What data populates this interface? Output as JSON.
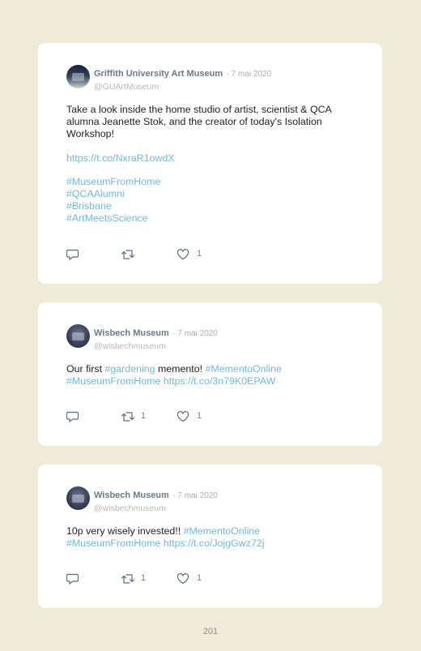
{
  "tweets": [
    {
      "name": "Griffith University Art Museum",
      "date": "· 7 mai 2020",
      "handle": "@GUArtMuseum",
      "lines": [
        {
          "text": "Take a look inside the home studio of artist, scientist & QCA"
        },
        {
          "text": "alumna Jeanette Stok, and the creator of today's Isolation"
        },
        {
          "text": "Workshop!"
        },
        {
          "link": "https://t.co/NxraR1owdX"
        },
        {
          "link": "#MuseumFromHome"
        },
        {
          "link": "#QCAAlumni"
        },
        {
          "link": "#Brisbane"
        },
        {
          "link": "#ArtMeetsScience"
        }
      ],
      "reply_count": "",
      "retweet_count": "",
      "like_count": "1"
    },
    {
      "name": "Wisbech Museum",
      "date": "· 7 mai 2020",
      "handle": "@wisbechmuseum",
      "line1": {
        "t1": "Our first ",
        "l1": "#gardening",
        "t2": " memento! ",
        "l2": "#MementoOnline"
      },
      "line2": {
        "l1": "#MuseumFromHome",
        "l2": "https://t.co/3n79K0EPAW"
      },
      "reply_count": "",
      "retweet_count": "1",
      "like_count": "1"
    },
    {
      "name": "Wisbech Museum",
      "date": "· 7 mai 2020",
      "handle": "@wisbechmuseum",
      "line1": {
        "t1": "10p very wisely invested!! ",
        "l1": "#MementoOnline"
      },
      "line2": {
        "l1": "#MuseumFromHome",
        "l2": "https://t.co/JojgGwz72j"
      },
      "reply_count": "",
      "retweet_count": "1",
      "like_count": "1"
    }
  ],
  "page_number": "201",
  "colors": {
    "background": "#f0ead9",
    "card": "#ffffff",
    "link": "#6fb9dc",
    "name": "#6a7a8c",
    "meta": "#a6afb9"
  },
  "icons": [
    "reply-icon",
    "retweet-icon",
    "like-icon"
  ]
}
